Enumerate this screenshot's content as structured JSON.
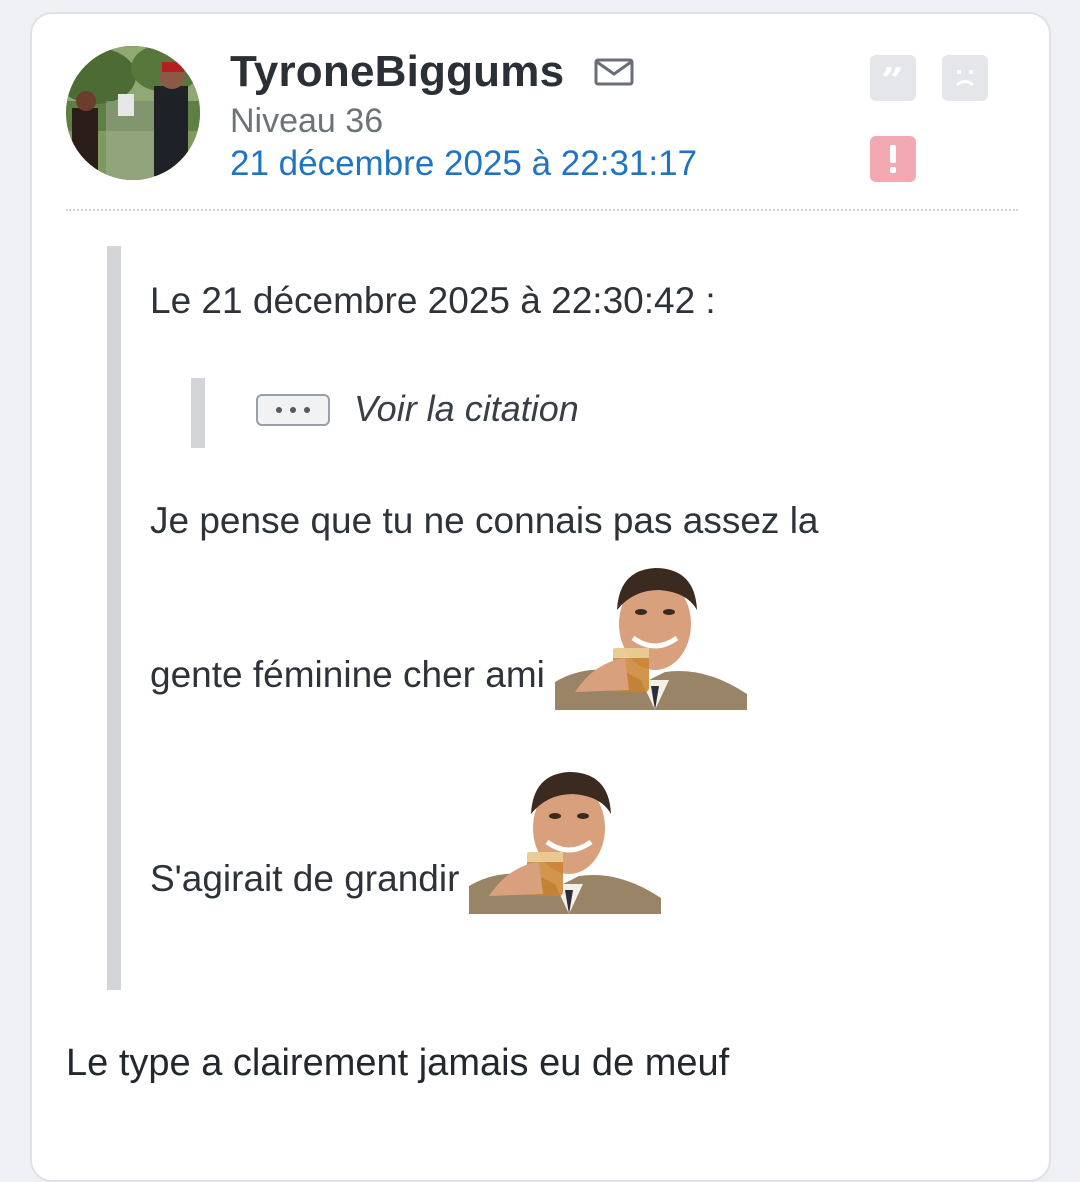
{
  "post": {
    "username": "TyroneBiggums",
    "level": "Niveau 36",
    "date": "21 décembre 2025 à 22:31:17",
    "icons": {
      "mail": "mail-icon",
      "quote": "quote-icon",
      "sad": "sad-face-icon",
      "report": "report-icon"
    },
    "colors": {
      "link": "#1f74c4",
      "report": "#f2a9b1",
      "quote_bar": "#d3d5d9"
    }
  },
  "quote": {
    "meta": "Le 21 décembre 2025 à 22:30:42 :",
    "nested_label": "Voir la citation",
    "line1": "Je pense que tu ne connais pas assez la",
    "line2": "gente féminine cher ami",
    "line3": "S'agirait de grandir",
    "sticker_icon": "laughing-man-sticker"
  },
  "reply": {
    "text": "Le type a clairement jamais eu de meuf"
  }
}
